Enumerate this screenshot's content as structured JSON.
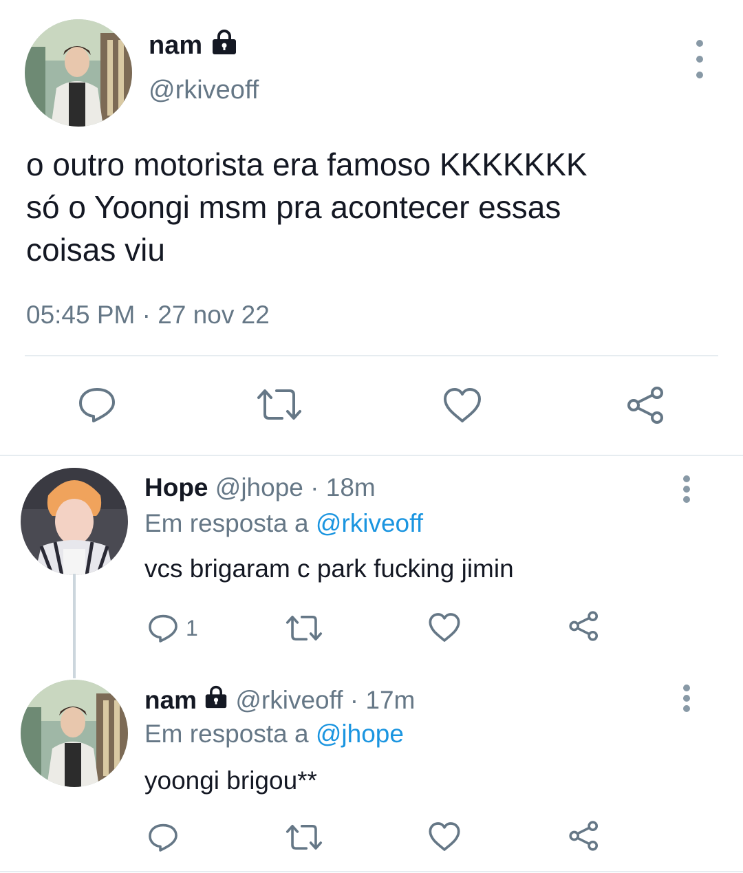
{
  "main_tweet": {
    "name": "nam",
    "handle": "@rkiveoff",
    "body_lines": [
      "o outro motorista era famoso KKKKKKK",
      "só o Yoongi msm pra acontecer essas",
      "coisas viu"
    ],
    "timestamp": "05:45 PM · 27 nov 22",
    "actions": [
      "reply-icon",
      "retweet-icon",
      "like-icon",
      "share-icon"
    ]
  },
  "replies": [
    {
      "name": "Hope",
      "handle": "@jhope",
      "time": "· 18m",
      "reply_prefix": "Em resposta a",
      "reply_to": "@rkiveoff",
      "body": "vcs brigaram c park fucking jimin",
      "reply_count": "1",
      "locked": false
    },
    {
      "name": "nam",
      "handle": "@rkiveoff",
      "time": "· 17m",
      "reply_prefix": "Em resposta a",
      "reply_to": "@jhope",
      "body": "yoongi brigou**",
      "reply_count": "",
      "locked": true
    }
  ],
  "colors": {
    "text": "#141823",
    "muted": "#657786",
    "link": "#1b95e0",
    "divider": "#e6ecf0"
  }
}
